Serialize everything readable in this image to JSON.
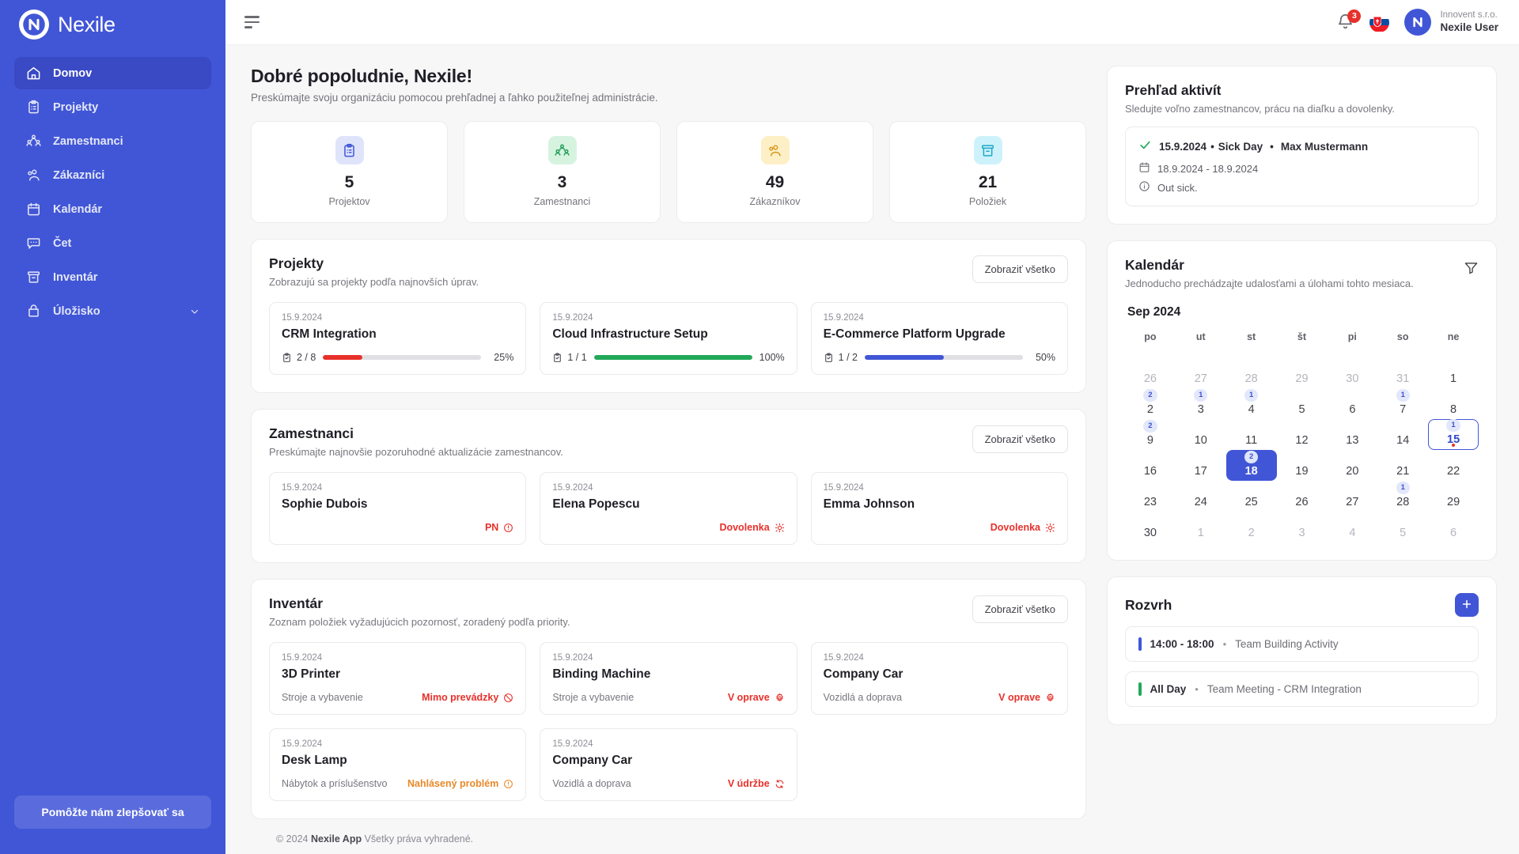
{
  "brand": {
    "name": "Nexile",
    "logo_icon": "nexile-logo-icon"
  },
  "sidebar": {
    "items": [
      {
        "label": "Domov",
        "icon": "home-icon",
        "active": true
      },
      {
        "label": "Projekty",
        "icon": "clipboard-icon",
        "active": false
      },
      {
        "label": "Zamestnanci",
        "icon": "users-group-icon",
        "active": false
      },
      {
        "label": "Zákazníci",
        "icon": "users-icon",
        "active": false
      },
      {
        "label": "Kalendár",
        "icon": "calendar-icon",
        "active": false
      },
      {
        "label": "Čet",
        "icon": "chat-icon",
        "active": false
      },
      {
        "label": "Inventár",
        "icon": "box-icon",
        "active": false
      },
      {
        "label": "Úložisko",
        "icon": "archive-icon",
        "active": false,
        "expandable": true
      }
    ],
    "improve_button": "Pomôžte nám zlepšovať sa"
  },
  "topbar": {
    "menu_icon": "hamburger-menu-icon",
    "notifications": {
      "icon": "bell-icon",
      "count": "3"
    },
    "language": {
      "icon": "slovakia-flag-icon"
    },
    "user": {
      "org": "Innovent s.r.o.",
      "name": "Nexile User",
      "avatar_icon": "user-avatar-icon"
    }
  },
  "greeting": {
    "title": "Dobré popoludnie, Nexile!",
    "subtitle": "Preskúmajte svoju organizáciu pomocou prehľadnej a ľahko použiteľnej administrácie."
  },
  "stats": [
    {
      "value": "5",
      "label": "Projektov",
      "icon": "clipboard-icon",
      "fg": "#4156d6",
      "bg": "#dfe4fb"
    },
    {
      "value": "3",
      "label": "Zamestnanci",
      "icon": "users-group-icon",
      "fg": "#1f9d55",
      "bg": "#d6f3e0"
    },
    {
      "value": "49",
      "label": "Zákazníkov",
      "icon": "users-icon",
      "fg": "#d99218",
      "bg": "#fdf0c6"
    },
    {
      "value": "21",
      "label": "Položiek",
      "icon": "box-icon",
      "fg": "#1fa8c9",
      "bg": "#cdf2fb"
    }
  ],
  "projects": {
    "title": "Projekty",
    "subtitle": "Zobrazujú sa projekty podľa najnovších úprav.",
    "show_all": "Zobraziť všetko",
    "items": [
      {
        "date": "15.9.2024",
        "name": "CRM Integration",
        "tasks": "2 / 8",
        "percent": "25%",
        "progress": 25,
        "color": "#e8302a"
      },
      {
        "date": "15.9.2024",
        "name": "Cloud Infrastructure Setup",
        "tasks": "1 / 1",
        "percent": "100%",
        "progress": 100,
        "color": "#22a95a"
      },
      {
        "date": "15.9.2024",
        "name": "E-Commerce Platform Upgrade",
        "tasks": "1 / 2",
        "percent": "50%",
        "progress": 50,
        "color": "#4156d6"
      }
    ]
  },
  "employees": {
    "title": "Zamestnanci",
    "subtitle": "Preskúmajte najnovšie pozoruhodné aktualizácie zamestnancov.",
    "show_all": "Zobraziť všetko",
    "items": [
      {
        "date": "15.9.2024",
        "name": "Sophie Dubois",
        "status": "PN",
        "status_icon": "alert-circle-icon",
        "color": "#e8302a"
      },
      {
        "date": "15.9.2024",
        "name": "Elena Popescu",
        "status": "Dovolenka",
        "status_icon": "sun-icon",
        "color": "#e8302a"
      },
      {
        "date": "15.9.2024",
        "name": "Emma Johnson",
        "status": "Dovolenka",
        "status_icon": "sun-icon",
        "color": "#e8302a"
      }
    ]
  },
  "inventory": {
    "title": "Inventár",
    "subtitle": "Zoznam položiek vyžadujúcich pozornosť, zoradený podľa priority.",
    "show_all": "Zobraziť všetko",
    "items": [
      {
        "date": "15.9.2024",
        "name": "3D Printer",
        "category": "Stroje a vybavenie",
        "status": "Mimo prevádzky",
        "status_icon": "ban-icon",
        "color": "#e8302a"
      },
      {
        "date": "15.9.2024",
        "name": "Binding Machine",
        "category": "Stroje a vybavenie",
        "status": "V oprave",
        "status_icon": "gear-icon",
        "color": "#e8302a"
      },
      {
        "date": "15.9.2024",
        "name": "Company Car",
        "category": "Vozidlá a doprava",
        "status": "V oprave",
        "status_icon": "gear-icon",
        "color": "#e8302a"
      },
      {
        "date": "15.9.2024",
        "name": "Desk Lamp",
        "category": "Nábytok a príslušenstvo",
        "status": "Nahlásený problém",
        "status_icon": "alert-circle-icon",
        "color": "#e8892a"
      },
      {
        "date": "15.9.2024",
        "name": "Company Car",
        "category": "Vozidlá a doprava",
        "status": "V údržbe",
        "status_icon": "refresh-icon",
        "color": "#e8302a"
      }
    ]
  },
  "activity": {
    "title": "Prehľad aktivít",
    "subtitle": "Sledujte voľno zamestnancov, prácu na diaľku a dovolenky.",
    "entry": {
      "check_icon": "check-icon",
      "date": "15.9.2024",
      "type": "Sick Day",
      "person": "Max Mustermann",
      "range_icon": "calendar-icon",
      "range": "18.9.2024 - 18.9.2024",
      "note_icon": "info-icon",
      "note": "Out sick."
    }
  },
  "calendar": {
    "title": "Kalendár",
    "subtitle": "Jednoducho prechádzajte udalosťami a úlohami tohto mesiaca.",
    "filter_icon": "filter-icon",
    "month": "Sep 2024",
    "dow": [
      "po",
      "ut",
      "st",
      "št",
      "pi",
      "so",
      "ne"
    ],
    "weeks": [
      [
        {
          "d": "26",
          "muted": true
        },
        {
          "d": "27",
          "muted": true
        },
        {
          "d": "28",
          "muted": true
        },
        {
          "d": "29",
          "muted": true
        },
        {
          "d": "30",
          "muted": true
        },
        {
          "d": "31",
          "muted": true
        },
        {
          "d": "1"
        }
      ],
      [
        {
          "d": "2",
          "badge": "2"
        },
        {
          "d": "3",
          "badge": "1"
        },
        {
          "d": "4",
          "badge": "1"
        },
        {
          "d": "5"
        },
        {
          "d": "6"
        },
        {
          "d": "7",
          "badge": "1"
        },
        {
          "d": "8"
        }
      ],
      [
        {
          "d": "9",
          "badge": "2"
        },
        {
          "d": "10"
        },
        {
          "d": "11"
        },
        {
          "d": "12"
        },
        {
          "d": "13"
        },
        {
          "d": "14"
        },
        {
          "d": "15",
          "badge": "1",
          "today": true,
          "dot": true
        }
      ],
      [
        {
          "d": "16"
        },
        {
          "d": "17"
        },
        {
          "d": "18",
          "badge": "2",
          "selected": true
        },
        {
          "d": "19"
        },
        {
          "d": "20"
        },
        {
          "d": "21"
        },
        {
          "d": "22"
        }
      ],
      [
        {
          "d": "23"
        },
        {
          "d": "24"
        },
        {
          "d": "25"
        },
        {
          "d": "26"
        },
        {
          "d": "27"
        },
        {
          "d": "28",
          "badge": "1"
        },
        {
          "d": "29"
        }
      ],
      [
        {
          "d": "30"
        },
        {
          "d": "1",
          "muted": true
        },
        {
          "d": "2",
          "muted": true
        },
        {
          "d": "3",
          "muted": true
        },
        {
          "d": "4",
          "muted": true
        },
        {
          "d": "5",
          "muted": true
        },
        {
          "d": "6",
          "muted": true
        }
      ]
    ]
  },
  "schedule": {
    "title": "Rozvrh",
    "add_icon": "plus-icon",
    "items": [
      {
        "time": "14:00 - 18:00",
        "label": "Team Building Activity",
        "color": "#4156d6"
      },
      {
        "time": "All Day",
        "label": "Team Meeting - CRM Integration",
        "color": "#22a95a"
      }
    ]
  },
  "footer": {
    "copy": "© 2024 ",
    "app": "Nexile App",
    "rights": " Všetky práva vyhradené."
  }
}
